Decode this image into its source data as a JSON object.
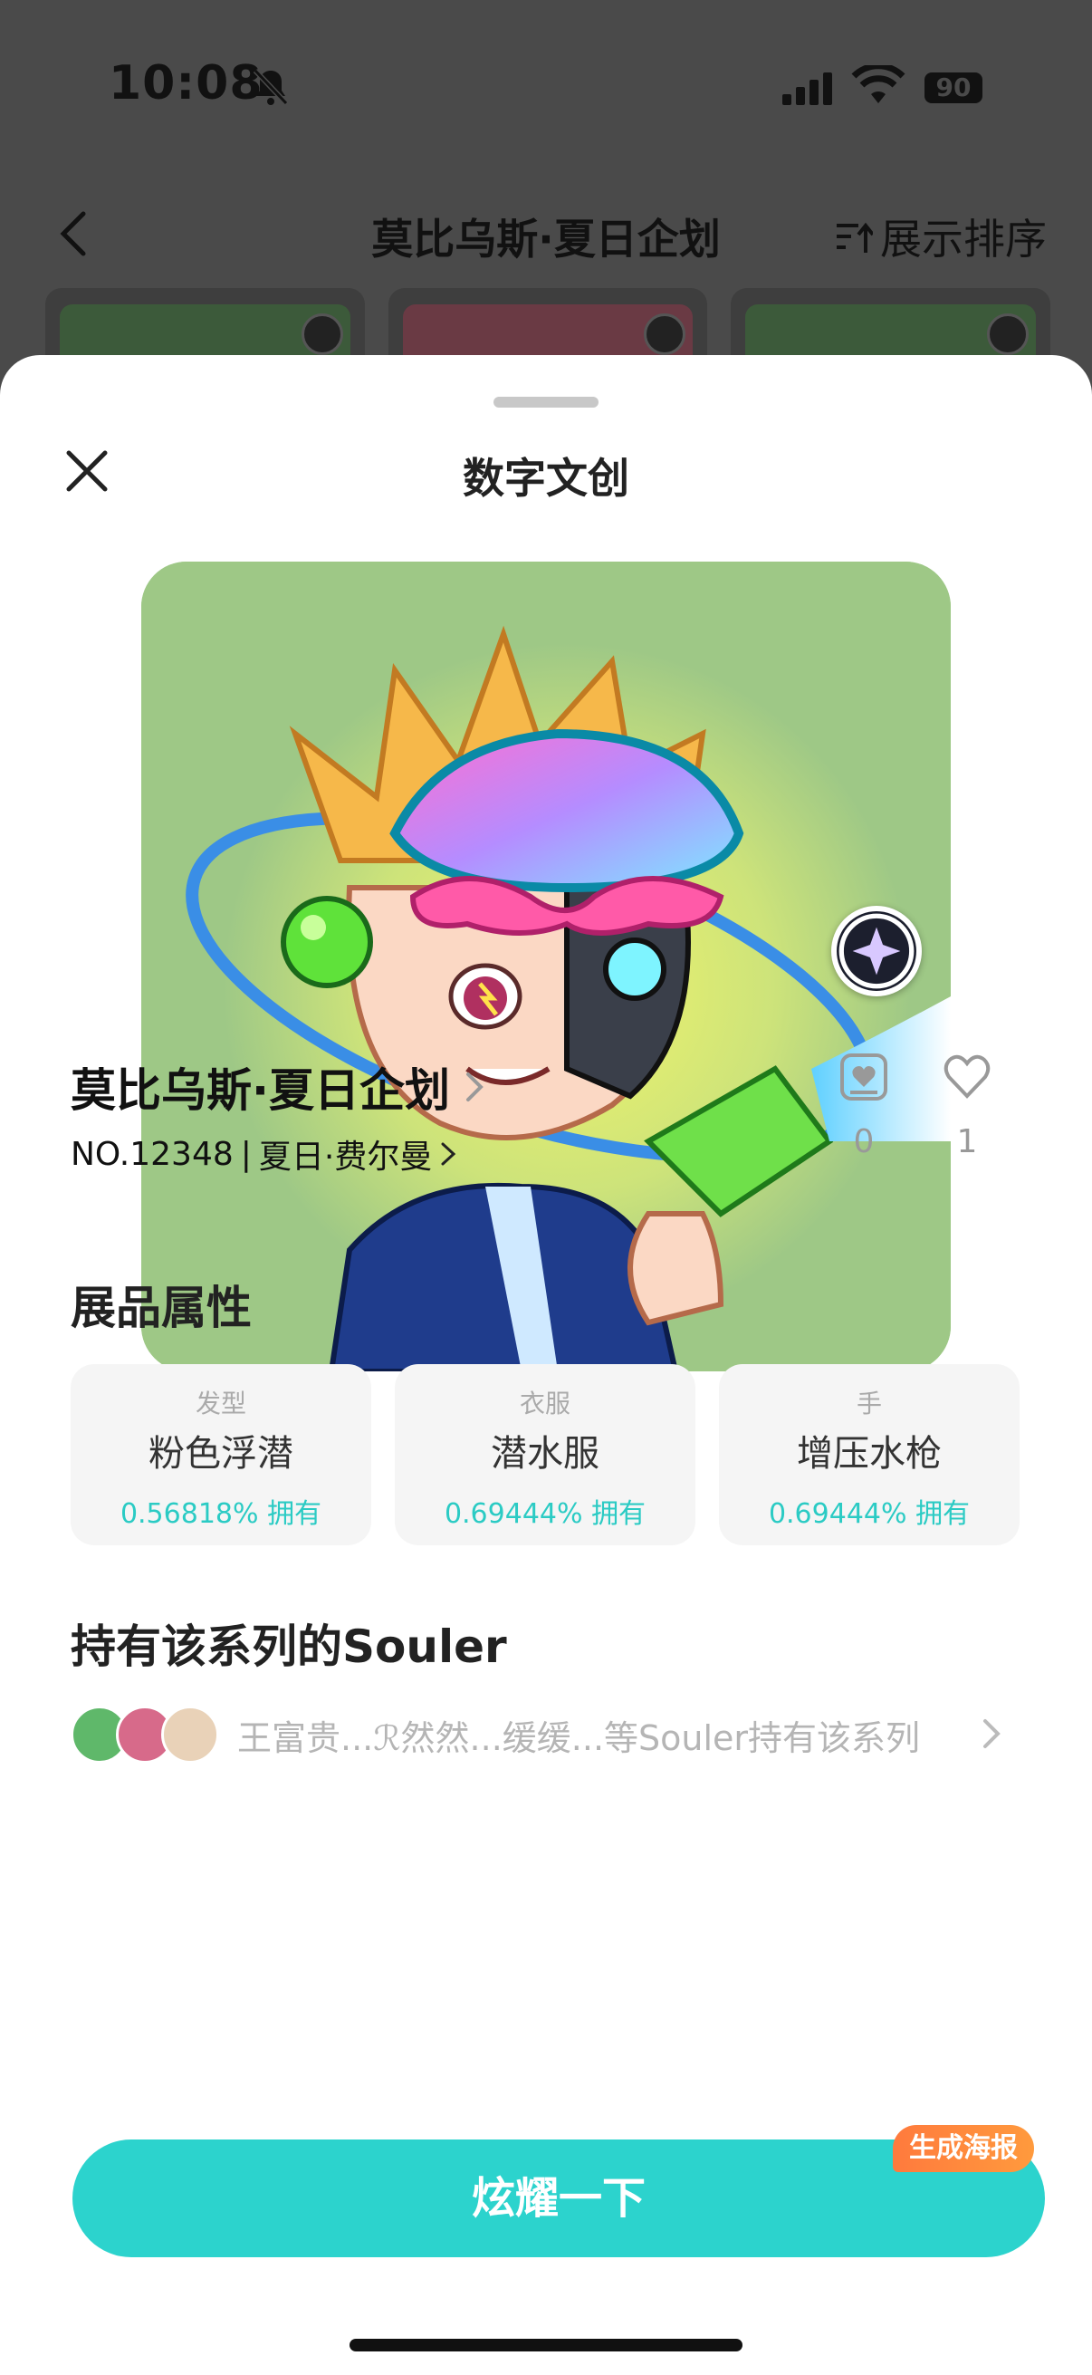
{
  "status_bar": {
    "time": "10:08",
    "battery": "90",
    "icons": [
      "bell-slash-icon",
      "signal-icon",
      "wifi-icon",
      "battery-icon"
    ]
  },
  "nav": {
    "back_icon": "chevron-left-icon",
    "title": "莫比乌斯·夏日企划",
    "sort_label": "展示排序",
    "sort_icon": "sort-icon"
  },
  "sheet": {
    "title": "数字文创",
    "close_icon": "close-icon"
  },
  "artwork": {
    "description_icon": "artwork-image",
    "badge_icon": "sparkle-badge-icon"
  },
  "item": {
    "title": "莫比乌斯·夏日企划",
    "number": "NO.12348",
    "separator": "|",
    "edition": "夏日·费尔曼",
    "collect_count": "0",
    "like_count": "1"
  },
  "attributes": {
    "section_title": "展品属性",
    "items": [
      {
        "name": "发型",
        "value": "粉色浮潜",
        "rate": "0.56818%",
        "owned": "拥有"
      },
      {
        "name": "衣服",
        "value": "潜水服",
        "rate": "0.69444%",
        "owned": "拥有"
      },
      {
        "name": "手",
        "value": "增压水枪",
        "rate": "0.69444%",
        "owned": "拥有"
      }
    ]
  },
  "holders": {
    "section_title": "持有该系列的Souler",
    "text": "王富贵...ℛ然然...缓缓...等Souler持有该系列"
  },
  "cta": {
    "label": "炫耀一下",
    "badge": "生成海报"
  },
  "colors": {
    "accent": "#2cd3cd",
    "rate_text": "#2bcbc4",
    "badge_orange": "#ff8a3d"
  }
}
